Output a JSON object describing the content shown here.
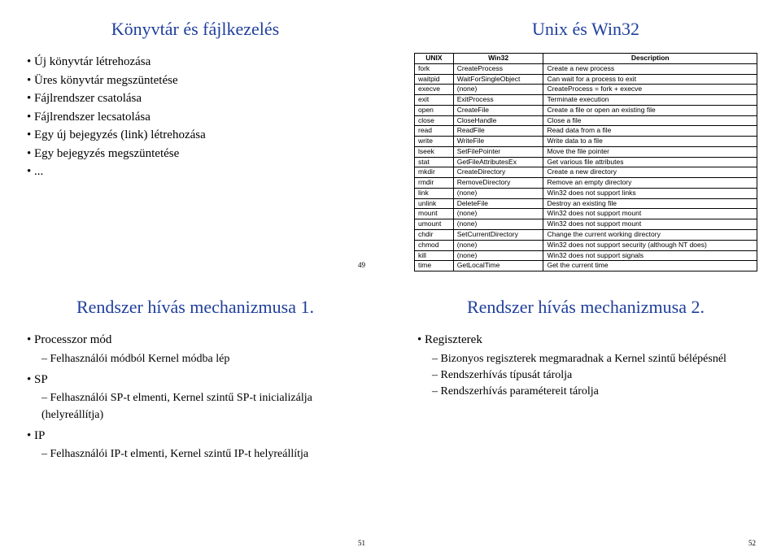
{
  "slide49": {
    "title": "Könyvtár és fájlkezelés",
    "items": [
      "Új könyvtár létrehozása",
      "Üres könyvtár megszüntetése",
      "Fájlrendszer csatolása",
      "Fájlrendszer lecsatolása",
      "Egy új bejegyzés (link) létrehozása",
      "Egy bejegyzés megszüntetése",
      "..."
    ],
    "page": "49"
  },
  "slide50": {
    "title": "Unix és Win32",
    "headers": [
      "UNIX",
      "Win32",
      "Description"
    ],
    "rows": [
      [
        "fork",
        "CreateProcess",
        "Create a new process"
      ],
      [
        "waitpid",
        "WaitForSingleObject",
        "Can wait for a process to exit"
      ],
      [
        "execve",
        "(none)",
        "CreateProcess = fork + execve"
      ],
      [
        "exit",
        "ExitProcess",
        "Terminate execution"
      ],
      [
        "open",
        "CreateFile",
        "Create a file or open an existing file"
      ],
      [
        "close",
        "CloseHandle",
        "Close a file"
      ],
      [
        "read",
        "ReadFile",
        "Read data from a file"
      ],
      [
        "write",
        "WriteFile",
        "Write data to a file"
      ],
      [
        "lseek",
        "SetFilePointer",
        "Move the file pointer"
      ],
      [
        "stat",
        "GetFileAttributesEx",
        "Get various file attributes"
      ],
      [
        "mkdir",
        "CreateDirectory",
        "Create a new directory"
      ],
      [
        "rmdir",
        "RemoveDirectory",
        "Remove an empty directory"
      ],
      [
        "link",
        "(none)",
        "Win32 does not support links"
      ],
      [
        "unlink",
        "DeleteFile",
        "Destroy an existing file"
      ],
      [
        "mount",
        "(none)",
        "Win32 does not support mount"
      ],
      [
        "umount",
        "(none)",
        "Win32 does not support mount"
      ],
      [
        "chdir",
        "SetCurrentDirectory",
        "Change the current working directory"
      ],
      [
        "chmod",
        "(none)",
        "Win32 does not support security (although NT does)"
      ],
      [
        "kill",
        "(none)",
        "Win32 does not support signals"
      ],
      [
        "time",
        "GetLocalTime",
        "Get the current time"
      ]
    ]
  },
  "slide51": {
    "title": "Rendszer hívás mechanizmusa 1.",
    "b1": "Processzor mód",
    "b1s": [
      "Felhasználói módból Kernel módba lép"
    ],
    "b2": "SP",
    "b2s": [
      "Felhasználói SP-t elmenti, Kernel szintű SP-t inicializálja (helyreállítja)"
    ],
    "b3": "IP",
    "b3s": [
      "Felhasználói IP-t elmenti, Kernel szintű IP-t helyreállítja"
    ],
    "page": "51"
  },
  "slide52": {
    "title": "Rendszer hívás mechanizmusa 2.",
    "b1": "Regiszterek",
    "b1s": [
      "Bizonyos regiszterek megmaradnak a Kernel szintű bélépésnél",
      "Rendszerhívás típusát tárolja",
      "Rendszerhívás paramétereit tárolja"
    ],
    "page": "52"
  }
}
